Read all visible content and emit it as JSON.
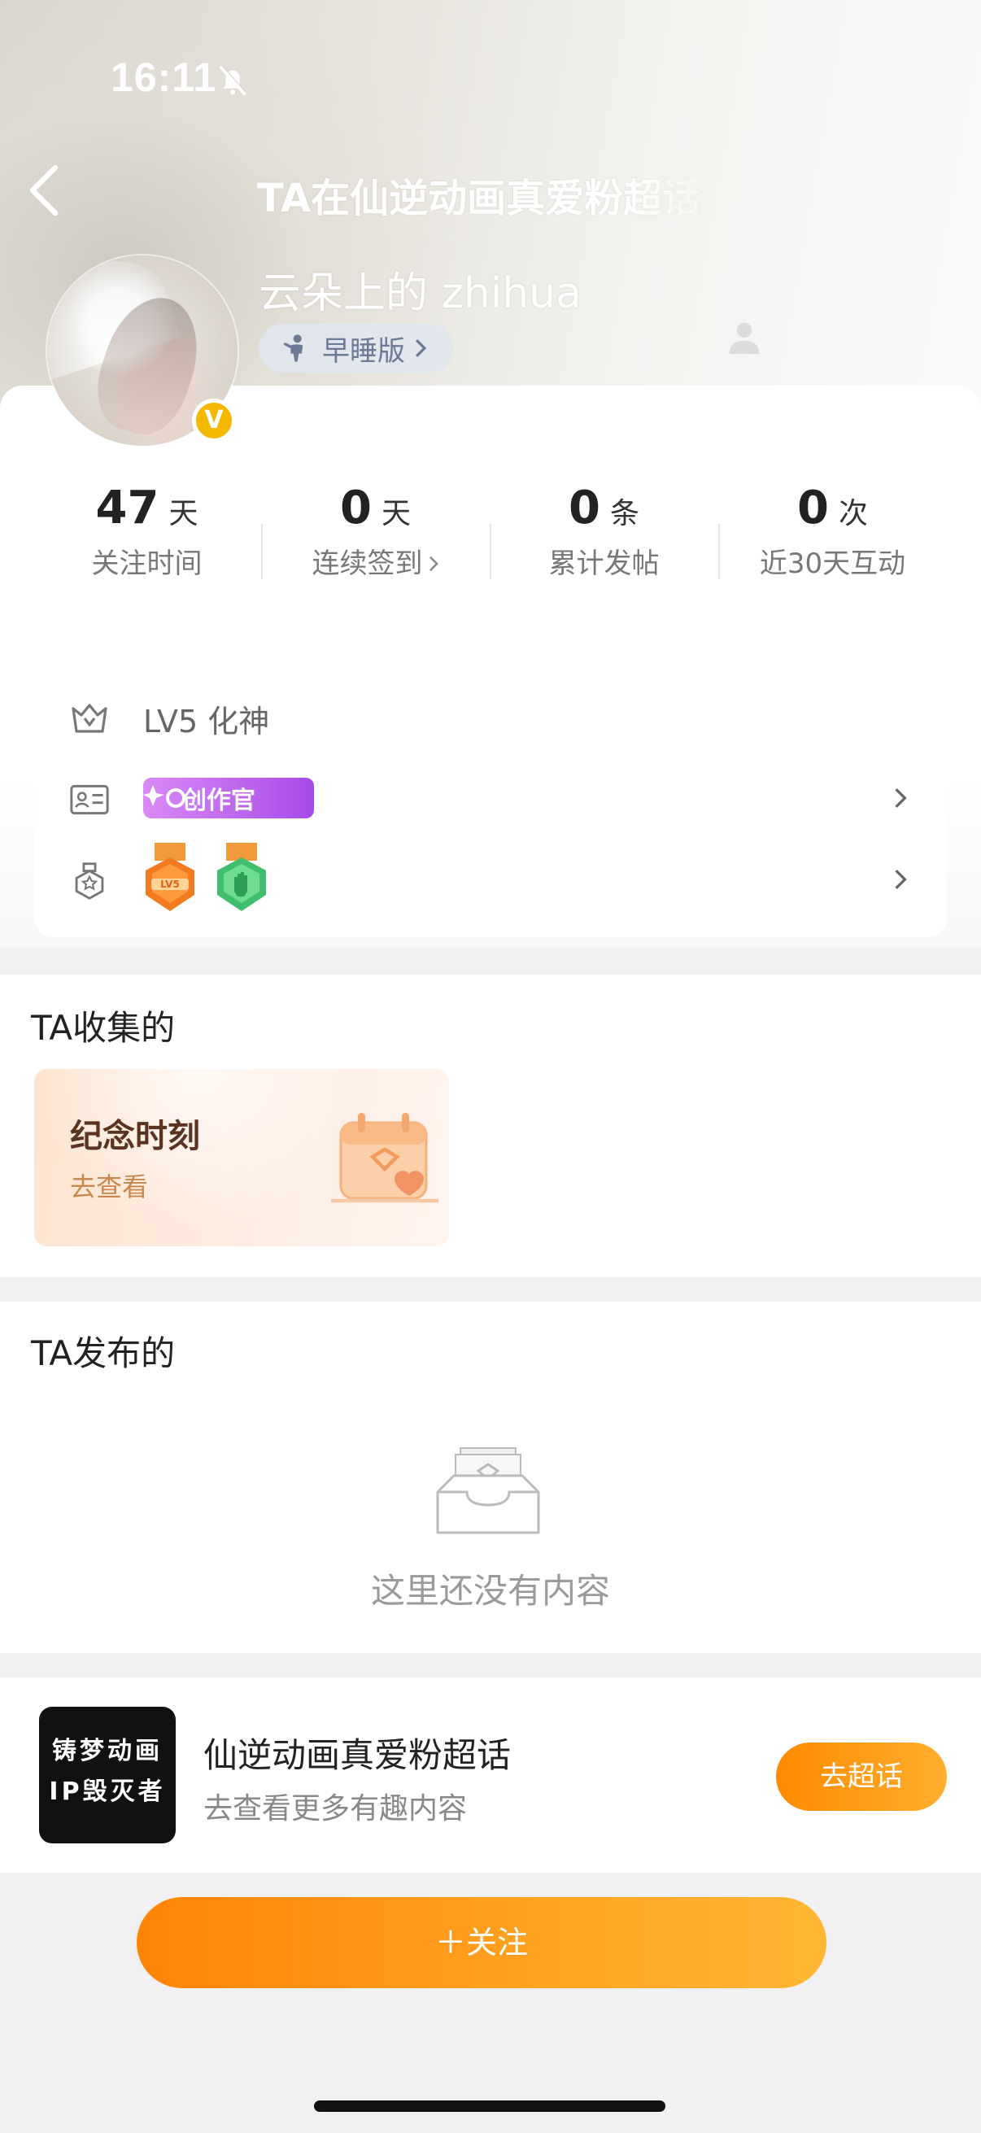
{
  "status_bar": {
    "time": "16:11"
  },
  "header": {
    "title": "TA在仙逆动画真爱粉超话"
  },
  "profile": {
    "username": "云朵上的 zhihua",
    "badge_letter": "V",
    "sleep_chip_label": "早睡版"
  },
  "stats": [
    {
      "value": "47",
      "unit": "天",
      "label": "关注时间"
    },
    {
      "value": "0",
      "unit": "天",
      "label": "连续签到"
    },
    {
      "value": "0",
      "unit": "条",
      "label": "累计发帖"
    },
    {
      "value": "0",
      "unit": "次",
      "label": "近30天互动"
    }
  ],
  "info": {
    "level_text": "LV5 化神",
    "creator_badge": "创作官",
    "medals": [
      "LV5",
      "hand"
    ]
  },
  "collected": {
    "title": "TA收集的",
    "card_title": "纪念时刻",
    "card_action": "去查看"
  },
  "posts": {
    "title": "TA发布的",
    "empty_text": "这里还没有内容"
  },
  "topic": {
    "logo_line1": "铸梦动画",
    "logo_line2": "IP毁灭者",
    "name": "仙逆动画真爱粉超话",
    "subtitle": "去查看更多有趣内容",
    "go_button": "去超话"
  },
  "follow_button": "＋关注",
  "colors": {
    "accent": "#ff9a1a",
    "badge": "#f5b800",
    "creator": "#b257ec"
  }
}
